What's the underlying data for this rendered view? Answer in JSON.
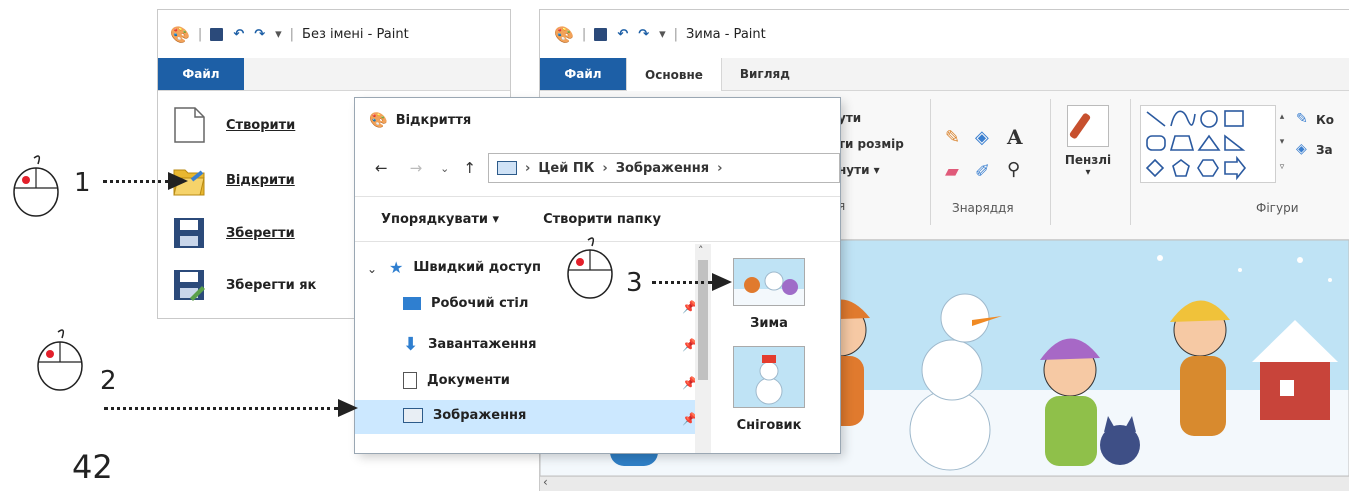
{
  "paint_small": {
    "title": "Без імені - Paint",
    "file_tab": "Файл",
    "menu": [
      {
        "label": "Створити",
        "icon": "new-file-icon"
      },
      {
        "label": "Відкрити",
        "icon": "open-folder-icon"
      },
      {
        "label": "Зберегти",
        "icon": "save-icon"
      },
      {
        "label": "Зберегти як",
        "icon": "save-as-icon"
      }
    ]
  },
  "paint_main": {
    "title": "Зима - Paint",
    "tabs": [
      "Файл",
      "Основне",
      "Вигляд"
    ],
    "image_group_partial": [
      "ути",
      "ти розмір",
      "нути ▾",
      "я"
    ],
    "tools_label": "Знаряддя",
    "brushes_label": "Пензлі",
    "shapes_label": "Фігури",
    "outline_partial": "Ко",
    "fill_partial": "За"
  },
  "open_dialog": {
    "title": "Відкриття",
    "path": [
      "Цей ПК",
      "Зображення"
    ],
    "toolbar": {
      "organize": "Упорядкувати ▾",
      "new_folder": "Створити папку"
    },
    "nav": [
      {
        "label": "Швидкий доступ",
        "icon": "star-icon"
      },
      {
        "label": "Робочий стіл",
        "icon": "desktop-icon"
      },
      {
        "label": "Завантаження",
        "icon": "download-icon"
      },
      {
        "label": "Документи",
        "icon": "documents-icon"
      },
      {
        "label": "Зображення",
        "icon": "pictures-icon"
      }
    ],
    "files": [
      {
        "label": "Зима"
      },
      {
        "label": "Сніговик"
      }
    ]
  },
  "steps": [
    "1",
    "2",
    "3"
  ],
  "page_number": "42",
  "colors": {
    "file_tab": "#1d5fa6",
    "selection": "#cce8ff",
    "sky": "#bfe3f5"
  }
}
